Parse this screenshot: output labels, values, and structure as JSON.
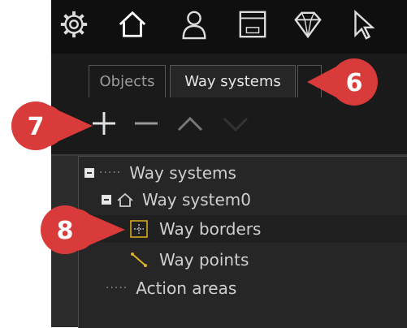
{
  "tabs": [
    {
      "label": "Objects"
    },
    {
      "label": "Way systems"
    }
  ],
  "actions": {
    "add": "add-icon",
    "remove": "remove-icon",
    "up": "move-up-icon",
    "down": "move-down-icon"
  },
  "tree": {
    "root": {
      "label": "Way systems"
    },
    "system": {
      "label": "Way system0"
    },
    "borders": {
      "label": "Way borders"
    },
    "points": {
      "label": "Way points"
    },
    "areas": {
      "label": "Action areas"
    }
  },
  "callouts": {
    "six": "6",
    "seven": "7",
    "eight": "8"
  },
  "colors": {
    "callout_red": "#d93a3a",
    "panel_dark": "#1a1a1a",
    "toolbar_black": "#0f0f0f",
    "border_icon_yellow": "#e0b020"
  }
}
